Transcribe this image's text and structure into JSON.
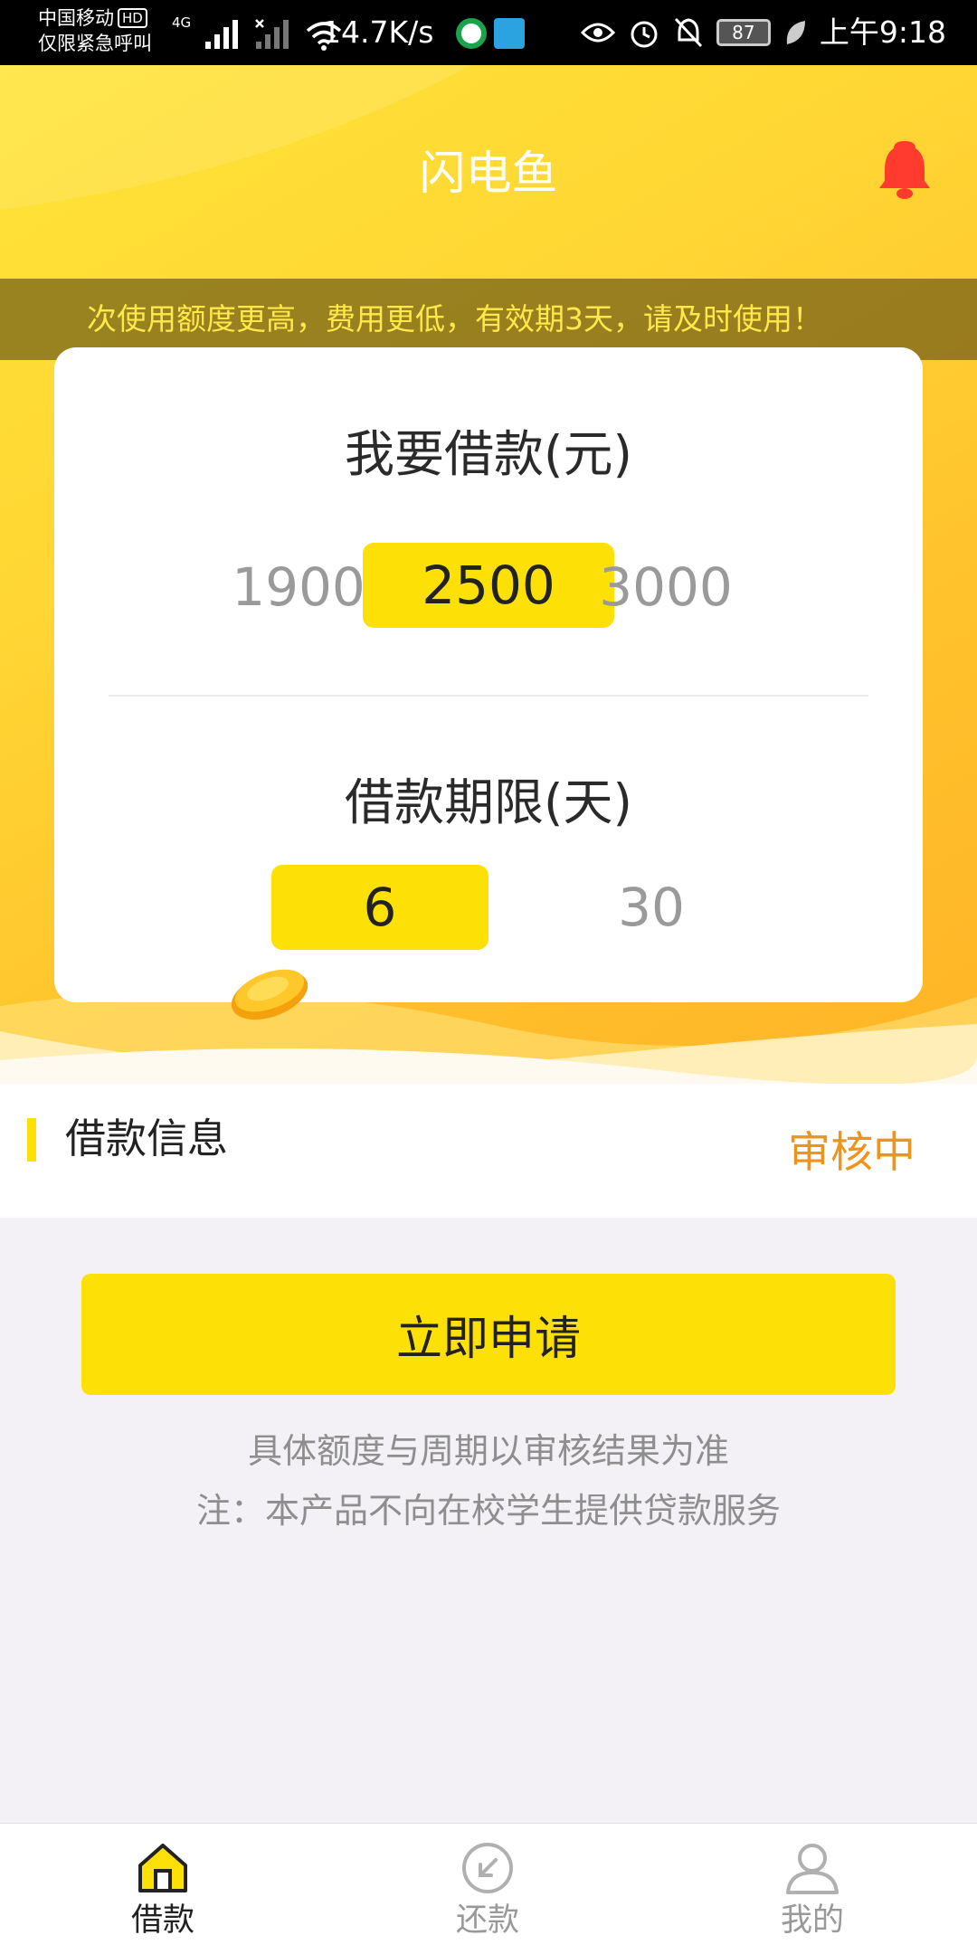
{
  "status_bar": {
    "carrier": "中国移动",
    "hd_badge": "HD",
    "emergency_text": "仅限紧急呼叫",
    "network_type": "4G",
    "net_speed": "14.7K/s",
    "battery_level": "87",
    "time": "上午9:18"
  },
  "header": {
    "title": "闪电鱼",
    "bell_color": "#ff3b30"
  },
  "notice": {
    "text": "次使用额度更高，费用更低，有效期3天，请及时使用！"
  },
  "loan_amount": {
    "heading": "我要借款(元)",
    "options": [
      "1900",
      "2500",
      "3000"
    ],
    "selected": "2500"
  },
  "loan_term": {
    "heading": "借款期限(天)",
    "options": [
      "6",
      "30"
    ],
    "selected": "6"
  },
  "loan_info": {
    "label": "借款信息",
    "status": "审核中"
  },
  "apply": {
    "button_label": "立即申请",
    "note_1": "具体额度与周期以审核结果为准",
    "note_2": "注：本产品不向在校学生提供贷款服务"
  },
  "bottom_nav": {
    "items": [
      {
        "label": "借款",
        "icon": "home-icon",
        "active": true
      },
      {
        "label": "还款",
        "icon": "repay-icon",
        "active": false
      },
      {
        "label": "我的",
        "icon": "user-icon",
        "active": false
      }
    ]
  },
  "colors": {
    "accent_yellow": "#fde106",
    "status_orange": "#f0931a",
    "hero_gradient_start": "#ffe437",
    "hero_gradient_end": "#ffb427"
  }
}
